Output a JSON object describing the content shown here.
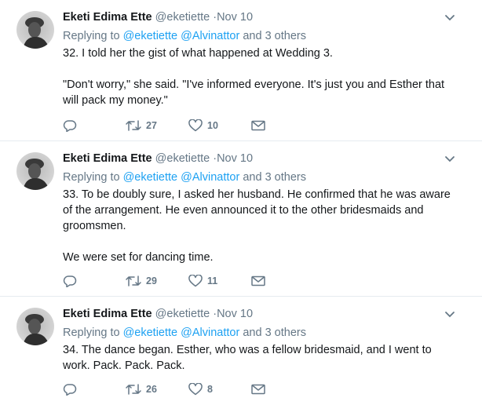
{
  "tweets": [
    {
      "name": "Eketi Edima Ette",
      "handle": "@eketiette",
      "dot": "·",
      "date": "Nov 10",
      "replying_label": "Replying to",
      "mention_1": "@eketiette",
      "mention_2": "@Alvinattor",
      "others": "and 3 others",
      "text": "32. I told her the gist of what happened at Wedding 3.\n\n\"Don't worry,\" she said. \"I've informed everyone. It's just you and Esther that will pack my money.\"",
      "retweets": "27",
      "likes": "10"
    },
    {
      "name": "Eketi Edima Ette",
      "handle": "@eketiette",
      "dot": "·",
      "date": "Nov 10",
      "replying_label": "Replying to",
      "mention_1": "@eketiette",
      "mention_2": "@Alvinattor",
      "others": "and 3 others",
      "text": "33. To be doubly sure, I asked her husband. He confirmed that he was aware of the arrangement. He even announced it to the other bridesmaids and groomsmen.\n\nWe were set for dancing time.",
      "retweets": "29",
      "likes": "11"
    },
    {
      "name": "Eketi Edima Ette",
      "handle": "@eketiette",
      "dot": "·",
      "date": "Nov 10",
      "replying_label": "Replying to",
      "mention_1": "@eketiette",
      "mention_2": "@Alvinattor",
      "others": "and 3 others",
      "text": "34. The dance began. Esther, who was a fellow bridesmaid, and I went to work. Pack. Pack. Pack.",
      "retweets": "26",
      "likes": "8"
    }
  ],
  "colors": {
    "link": "#1da1f2",
    "secondary": "#657786",
    "primary": "#14171a",
    "divider": "#e6ecf0"
  },
  "icons": {
    "reply": "reply-icon",
    "retweet": "retweet-icon",
    "like": "heart-icon",
    "message": "envelope-icon",
    "more": "chevron-down-icon"
  }
}
